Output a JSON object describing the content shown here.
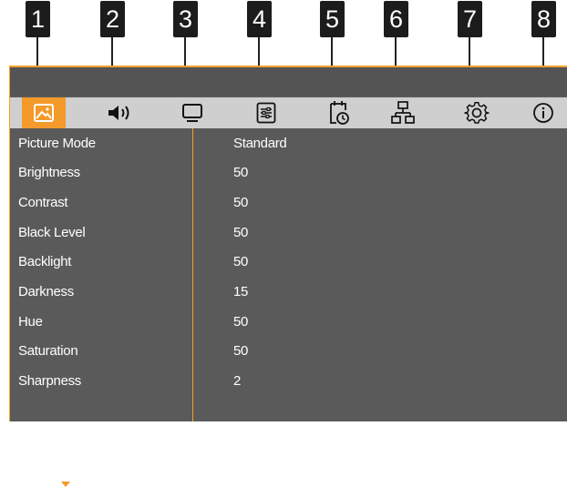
{
  "callouts": [
    "1",
    "2",
    "3",
    "4",
    "5",
    "6",
    "7",
    "8"
  ],
  "tabs": [
    {
      "icon": "picture-icon",
      "active": true
    },
    {
      "icon": "sound-icon",
      "active": false
    },
    {
      "icon": "display-icon",
      "active": false
    },
    {
      "icon": "adjustment-icon",
      "active": false
    },
    {
      "icon": "timer-icon",
      "active": false
    },
    {
      "icon": "network-icon",
      "active": false
    },
    {
      "icon": "settings-gear-icon",
      "active": false
    },
    {
      "icon": "info-icon",
      "active": false
    }
  ],
  "settings": [
    {
      "label": "Picture Mode",
      "value": "Standard"
    },
    {
      "label": "Brightness",
      "value": "50"
    },
    {
      "label": "Contrast",
      "value": "50"
    },
    {
      "label": "Black Level",
      "value": "50"
    },
    {
      "label": "Backlight",
      "value": "50"
    },
    {
      "label": "Darkness",
      "value": "15"
    },
    {
      "label": "Hue",
      "value": "50"
    },
    {
      "label": "Saturation",
      "value": "50"
    },
    {
      "label": "Sharpness",
      "value": "2"
    }
  ],
  "colors": {
    "accent": "#f39a2a",
    "panel": "#5a5a5a",
    "tabbar": "#cfcfcf"
  }
}
